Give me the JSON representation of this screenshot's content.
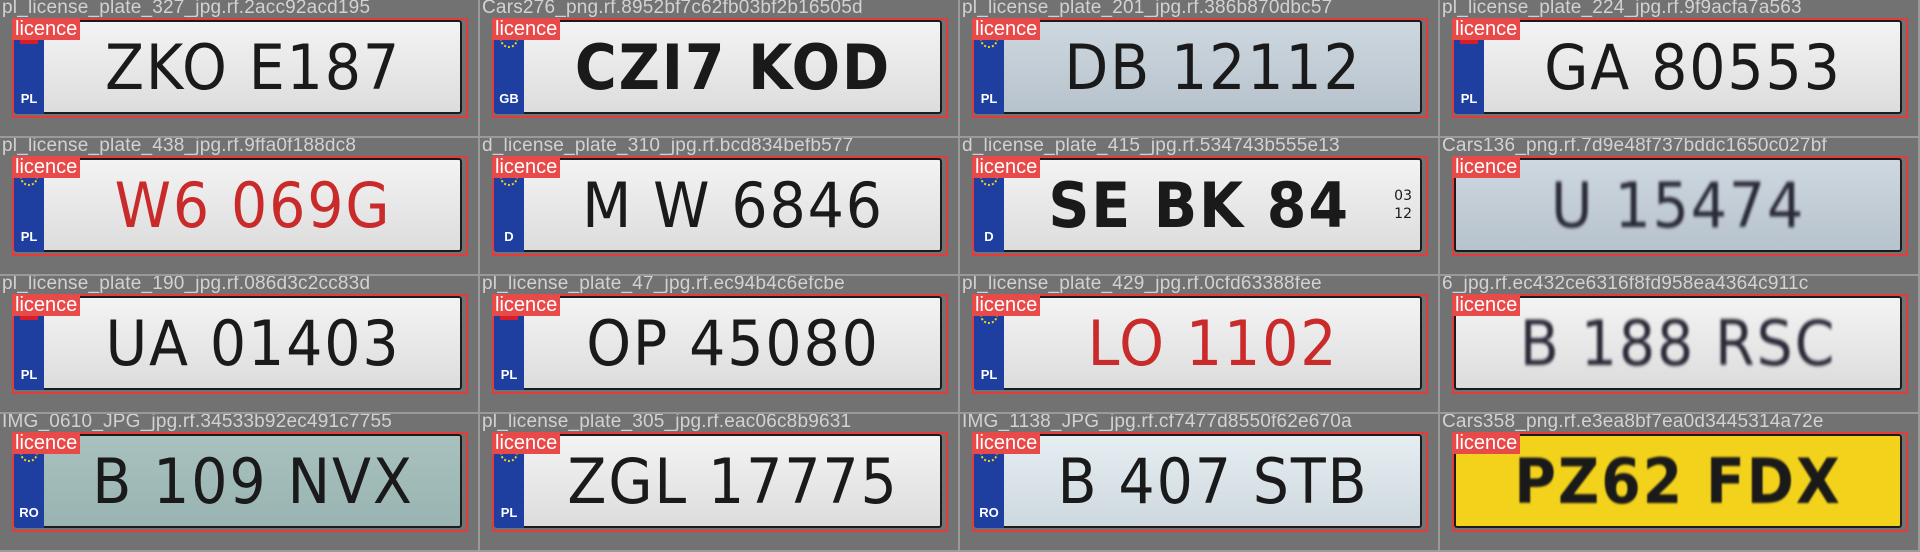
{
  "label_text": "licence",
  "colors": {
    "box": "#e23c3c",
    "label_bg": "#e84a4a",
    "tile_bg": "#727272"
  },
  "tiles": [
    {
      "filename": "pl_license_plate_327_jpg.rf.2acc92acd195",
      "plate": "ZKO E187",
      "band": "PL",
      "flag": "pl",
      "style": ""
    },
    {
      "filename": "Cars276_png.rf.8952bf7c62fb03bf2b16505d",
      "plate": "CZI7 KOD",
      "band": "GB",
      "flag": "eu",
      "style": "bold"
    },
    {
      "filename": "pl_license_plate_201_jpg.rf.386b870dbc57",
      "plate": "DB 12112",
      "band": "PL",
      "flag": "eu",
      "style": "blue-grey"
    },
    {
      "filename": "pl_license_plate_224_jpg.rf.9f9acfa7a563",
      "plate": "GA 80553",
      "band": "PL",
      "flag": "pl",
      "style": ""
    },
    {
      "filename": "pl_license_plate_438_jpg.rf.9ffa0f188dc8",
      "plate": "W6 069G",
      "band": "PL",
      "flag": "eu",
      "style": "red"
    },
    {
      "filename": "d_license_plate_310_jpg.rf.bcd834befb577",
      "plate": "M W 6846",
      "band": "D",
      "flag": "eu",
      "style": ""
    },
    {
      "filename": "d_license_plate_415_jpg.rf.534743b555e13",
      "plate": "SE BK 84",
      "band": "D",
      "flag": "eu",
      "style": "bold",
      "date_top": "03",
      "date_bottom": "12"
    },
    {
      "filename": "Cars136_png.rf.7d9e48f737bddc1650c027bf",
      "plate": "U 15474",
      "band": "",
      "flag": "none",
      "style": "blurred blue-grey"
    },
    {
      "filename": "pl_license_plate_190_jpg.rf.086d3c2cc83d",
      "plate": "UA 01403",
      "band": "PL",
      "flag": "pl",
      "style": ""
    },
    {
      "filename": "pl_license_plate_47_jpg.rf.ec94b4c6efcbe",
      "plate": "OP 45080",
      "band": "PL",
      "flag": "pl",
      "style": ""
    },
    {
      "filename": "pl_license_plate_429_jpg.rf.0cfd63388fee",
      "plate": "LO 1102",
      "band": "PL",
      "flag": "eu",
      "style": "red"
    },
    {
      "filename": "6_jpg.rf.ec432ce6316f8fd958ea4364c911c",
      "plate": "B 188 RSC",
      "band": "",
      "flag": "none",
      "style": "blurred"
    },
    {
      "filename": "IMG_0610_JPG_jpg.rf.34533b92ec491c7755",
      "plate": "B 109 NVX",
      "band": "RO",
      "flag": "eu",
      "style": "teal"
    },
    {
      "filename": "pl_license_plate_305_jpg.rf.eac06c8b9631",
      "plate": "ZGL 17775",
      "band": "PL",
      "flag": "eu",
      "style": ""
    },
    {
      "filename": "IMG_1138_JPG_jpg.rf.cf7477d8550f62e670a",
      "plate": "B 407 STB",
      "band": "RO",
      "flag": "eu",
      "style": "white-blue"
    },
    {
      "filename": "Cars358_png.rf.e3ea8bf7ea0d3445314a72e",
      "plate": "PZ62 FDX",
      "band": "",
      "flag": "none",
      "style": "yellow"
    }
  ]
}
